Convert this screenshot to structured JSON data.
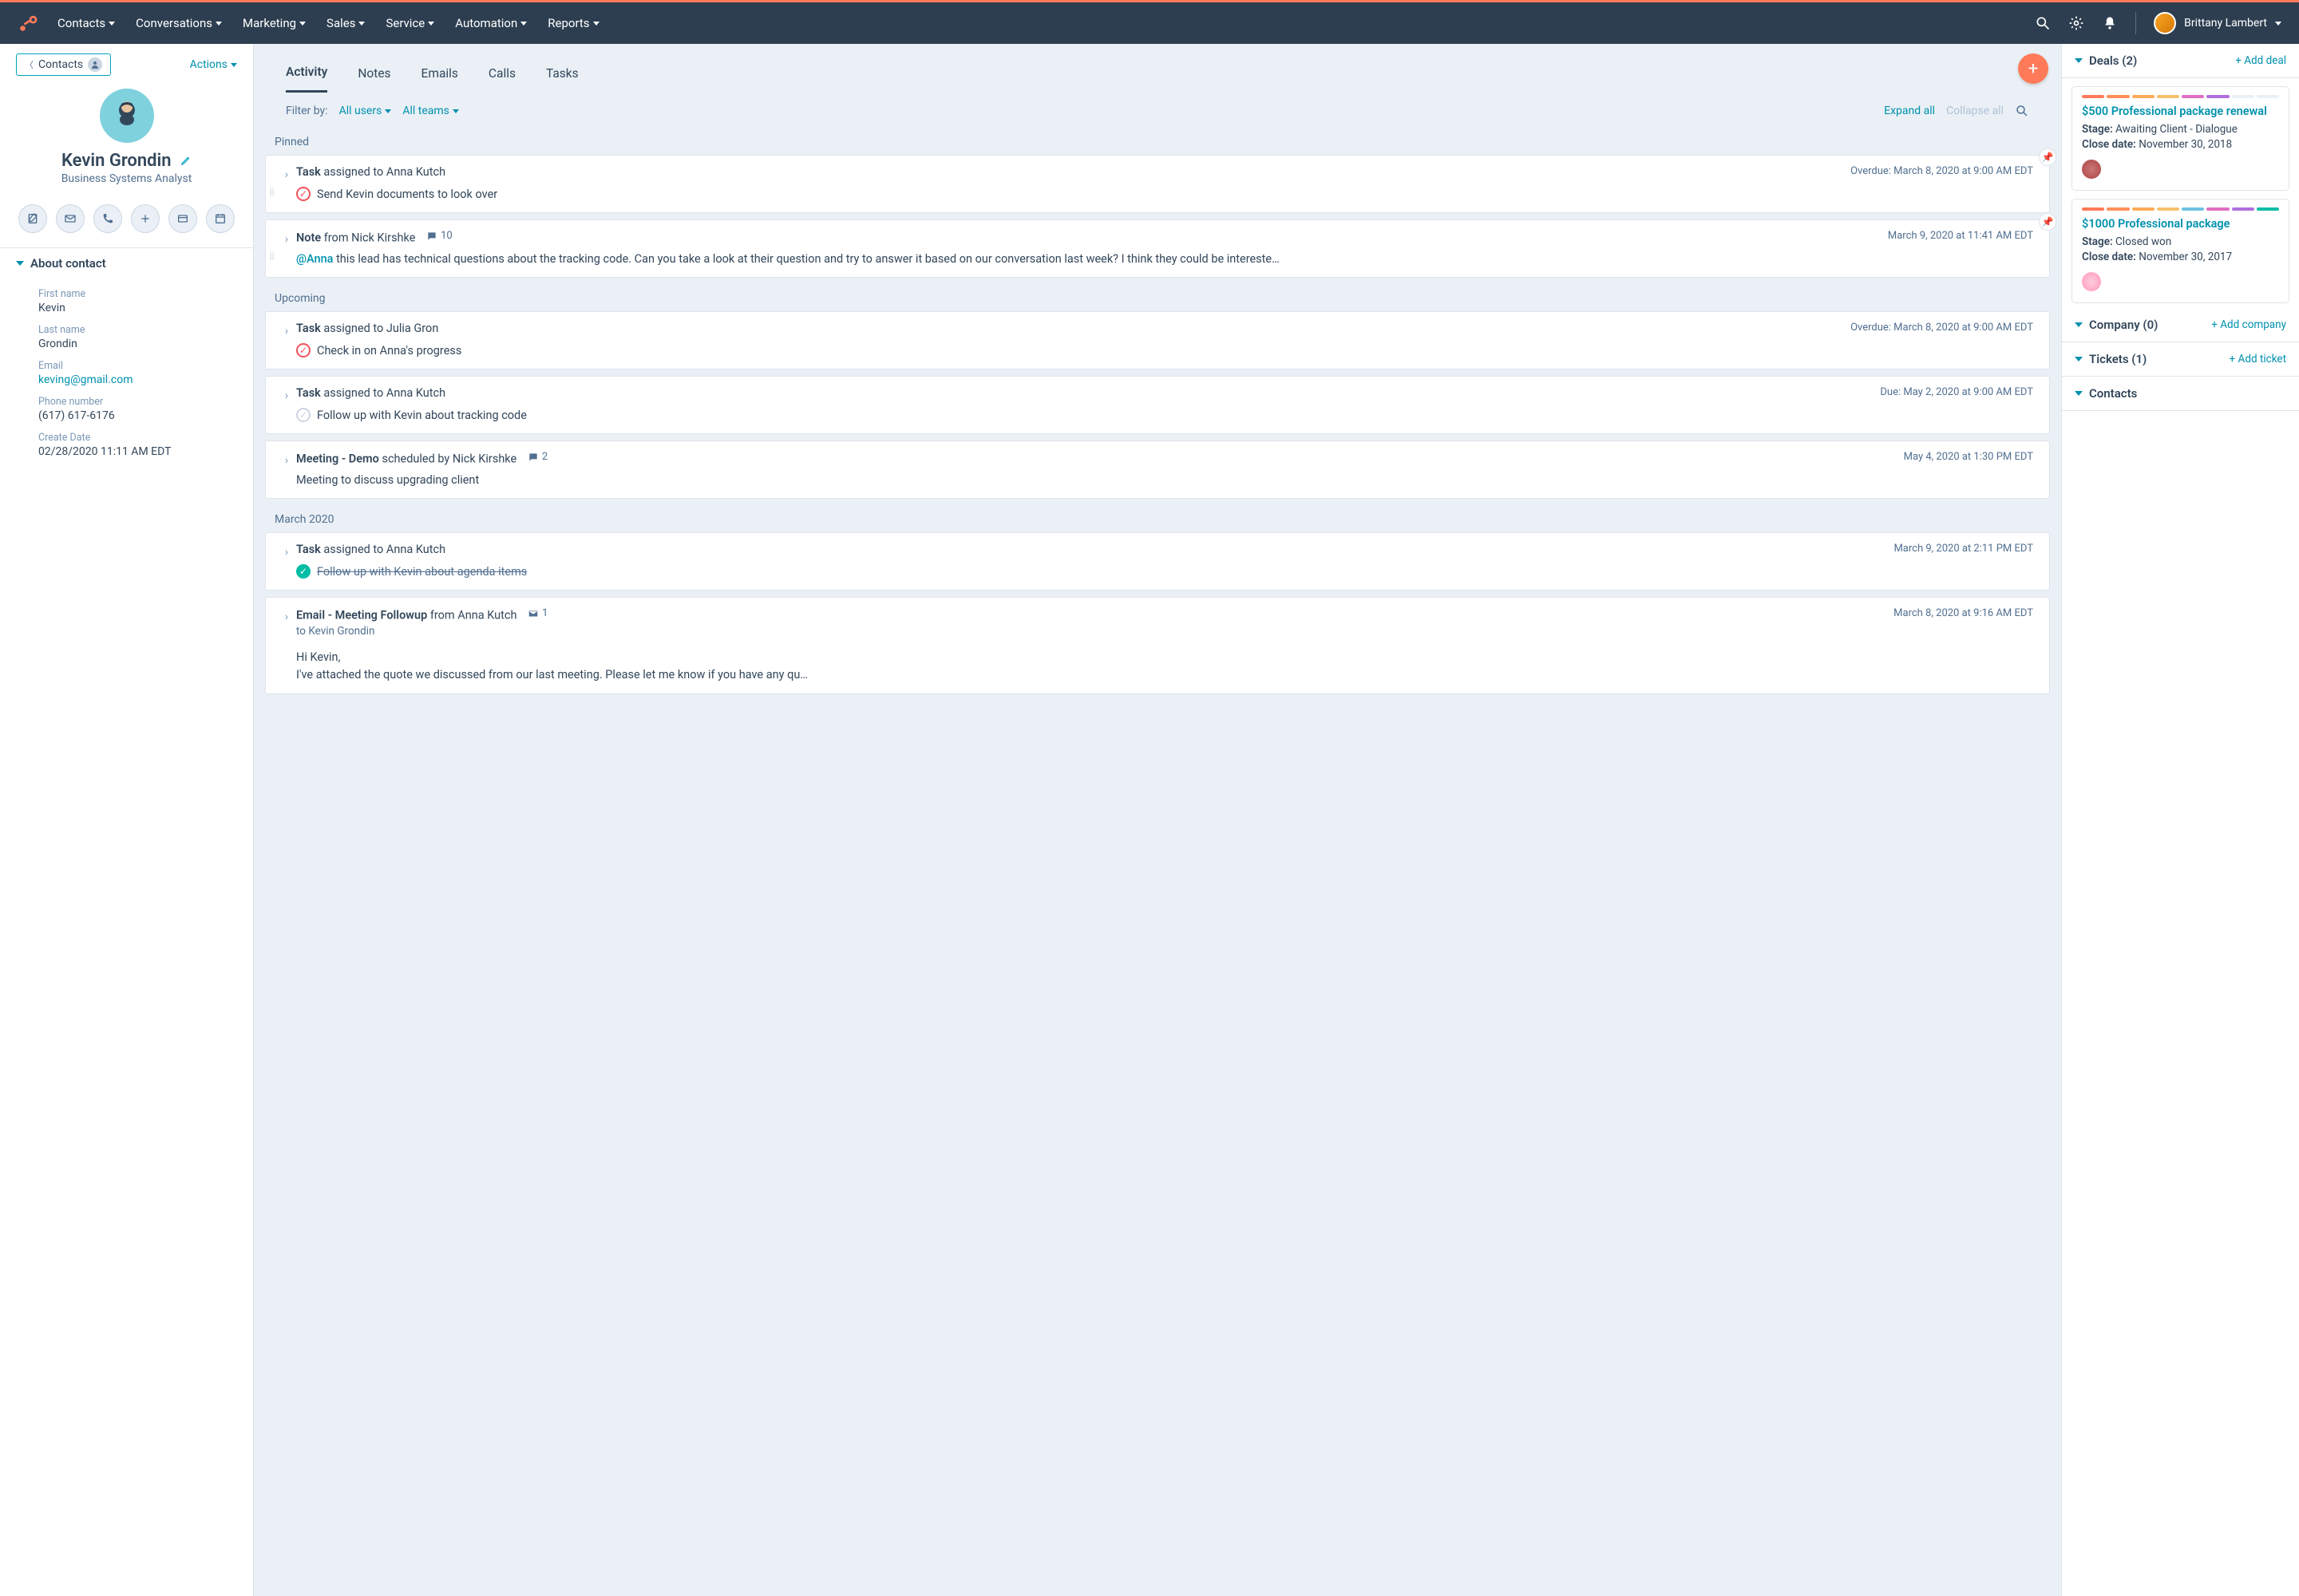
{
  "nav": {
    "items": [
      "Contacts",
      "Conversations",
      "Marketing",
      "Sales",
      "Service",
      "Automation",
      "Reports"
    ],
    "user": "Brittany Lambert"
  },
  "left": {
    "back": "Contacts",
    "actions": "Actions",
    "name": "Kevin Grondin",
    "role": "Business Systems Analyst",
    "about_header": "About contact",
    "fields": {
      "first_name_label": "First name",
      "first_name": "Kevin",
      "last_name_label": "Last name",
      "last_name": "Grondin",
      "email_label": "Email",
      "email": "keving@gmail.com",
      "phone_label": "Phone number",
      "phone": "(617) 617-6176",
      "create_label": "Create Date",
      "create": "02/28/2020 11:11 AM EDT"
    }
  },
  "middle": {
    "tabs": [
      "Activity",
      "Notes",
      "Emails",
      "Calls",
      "Tasks"
    ],
    "filter_label": "Filter by:",
    "filter_users": "All users",
    "filter_teams": "All teams",
    "expand": "Expand all",
    "collapse": "Collapse all",
    "groups": {
      "pinned": "Pinned",
      "upcoming": "Upcoming",
      "march": "March 2020"
    },
    "cards": {
      "p1": {
        "title_bold": "Task",
        "title_rest": " assigned to Anna Kutch",
        "time": "Overdue: March 8, 2020 at 9:00 AM EDT",
        "body": "Send Kevin documents to look over"
      },
      "p2": {
        "title_bold": "Note",
        "title_rest": " from Nick Kirshke",
        "comments": "10",
        "time": "March 9, 2020 at 11:41 AM EDT",
        "mention": "@Anna",
        "body": " this lead has technical questions about the tracking code. Can you take a look at their question and try to answer it based on our conversation last week? I think they could be intereste…"
      },
      "u1": {
        "title_bold": "Task",
        "title_rest": " assigned to Julia Gron",
        "time": "Overdue: March 8, 2020 at 9:00 AM EDT",
        "body": "Check in on Anna's progress"
      },
      "u2": {
        "title_bold": "Task",
        "title_rest": " assigned to Anna Kutch",
        "time": "Due: May 2, 2020 at 9:00 AM EDT",
        "body": "Follow up with Kevin about tracking code"
      },
      "u3": {
        "title_bold": "Meeting",
        "title_mid": " - Demo",
        "title_rest": " scheduled by Nick Kirshke",
        "comments": "2",
        "time": "May 4, 2020 at 1:30 PM EDT",
        "body": "Meeting to discuss upgrading client"
      },
      "m1": {
        "title_bold": "Task",
        "title_rest": " assigned to Anna Kutch",
        "time": "March 9, 2020 at 2:11 PM EDT",
        "body": "Follow up with Kevin about agenda items"
      },
      "m2": {
        "title_bold": "Email",
        "title_mid": " - Meeting Followup",
        "title_rest": " from Anna Kutch",
        "comments": "1",
        "time": "March 8, 2020 at 9:16 AM EDT",
        "to": "to Kevin Grondin",
        "body1": "Hi Kevin,",
        "body2": "I've attached the quote we discussed from our last meeting. Please let me know if you have any qu…"
      }
    }
  },
  "right": {
    "deals_header": "Deals (2)",
    "add_deal": "+ Add deal",
    "deal1": {
      "title": "$500 Professional package renewal",
      "stage_label": "Stage:",
      "stage": " Awaiting Client - Dialogue",
      "close_label": "Close date:",
      "close": " November 30, 2018"
    },
    "deal2": {
      "title": "$1000 Professional package",
      "stage_label": "Stage:",
      "stage": " Closed won",
      "close_label": "Close date:",
      "close": " November 30, 2017"
    },
    "company_header": "Company (0)",
    "add_company": "+ Add company",
    "tickets_header": "Tickets (1)",
    "add_ticket": "+ Add ticket",
    "contacts_header": "Contacts"
  }
}
